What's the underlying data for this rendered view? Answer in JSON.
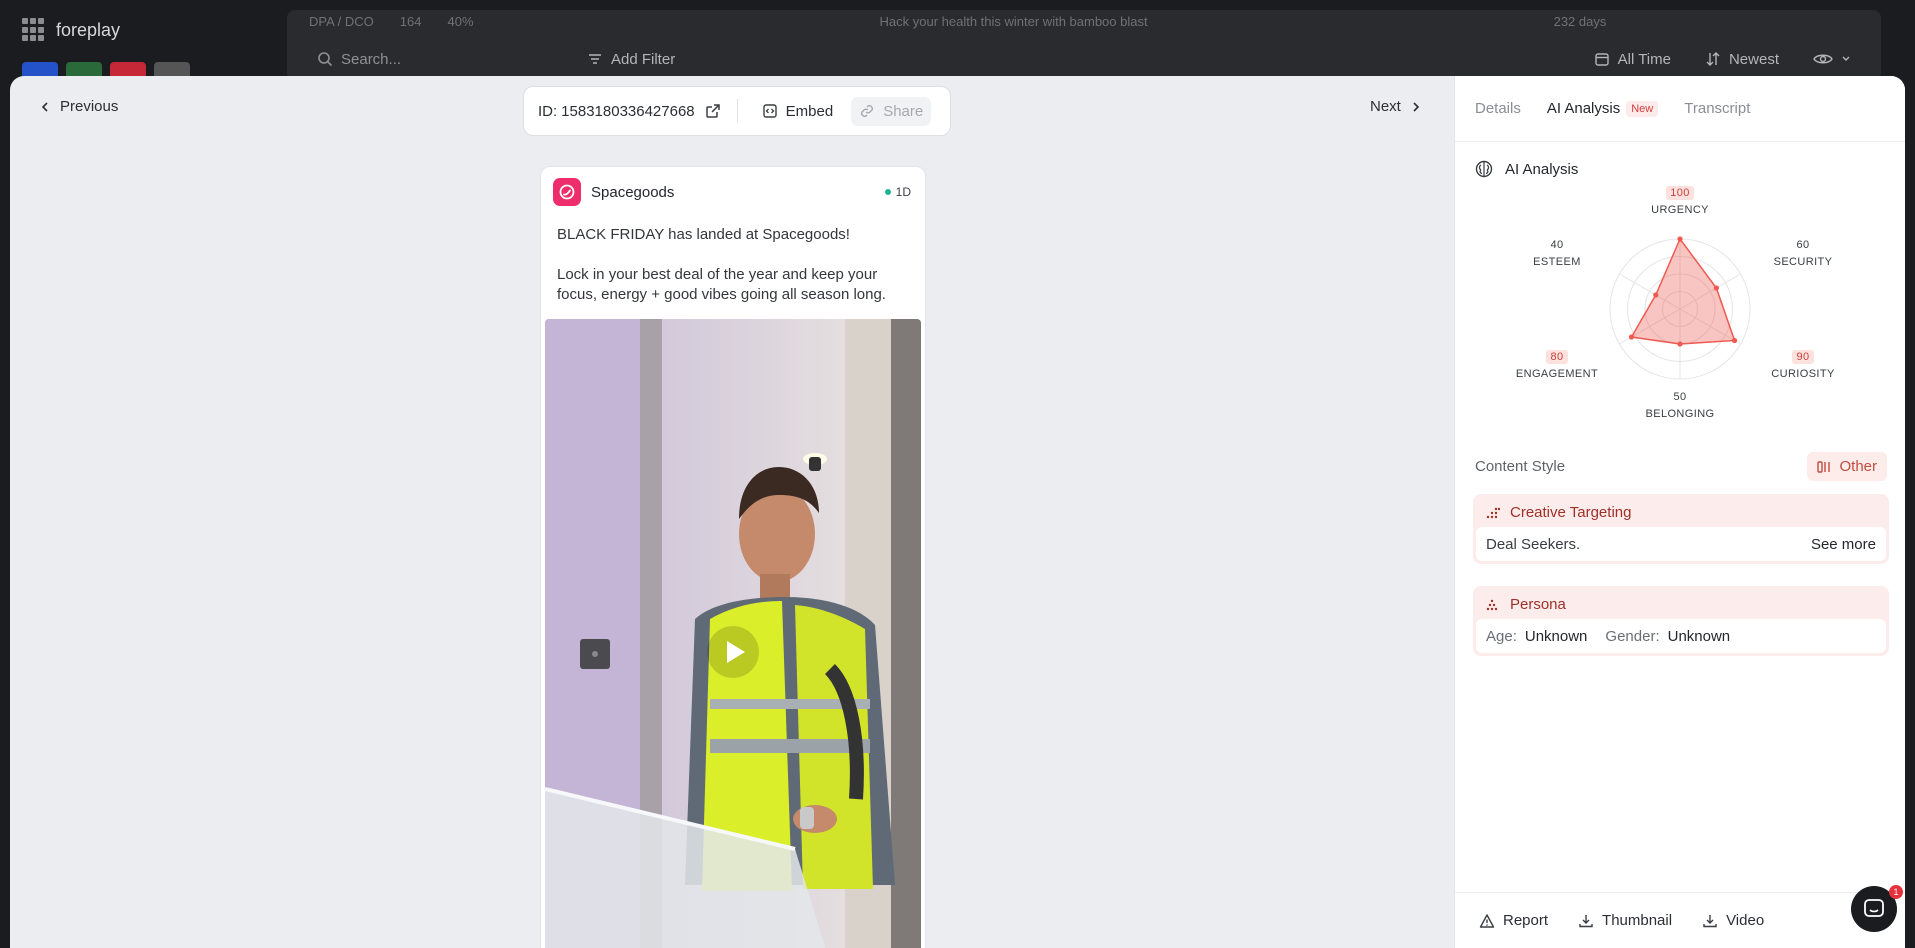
{
  "background": {
    "brand": "foreplay",
    "row1": [
      "DPA / DCO",
      "164",
      "40%",
      "Hack your health this winter with bamboo blast",
      "232 days"
    ],
    "search_placeholder": "Search...",
    "add_filter": "Add Filter",
    "all_time": "All Time",
    "newest": "Newest"
  },
  "nav": {
    "previous": "Previous",
    "next": "Next"
  },
  "idbar": {
    "id_prefix": "ID:",
    "id_value": "1583180336427668",
    "embed": "Embed",
    "share": "Share"
  },
  "ad": {
    "brand": "Spacegoods",
    "live_label": "1D",
    "copy": [
      "BLACK FRIDAY has landed at Spacegoods!",
      "Lock in your best deal of the year and keep your focus, energy + good vibes going all season long."
    ],
    "brand_color": "#ee2d6c"
  },
  "tabs": [
    {
      "label": "Details"
    },
    {
      "label": "AI Analysis",
      "badge": "New",
      "active": true
    },
    {
      "label": "Transcript"
    }
  ],
  "ai_analysis": {
    "title": "AI Analysis",
    "radar": [
      {
        "label": "URGENCY",
        "value": 100
      },
      {
        "label": "SECURITY",
        "value": 60
      },
      {
        "label": "CURIOSITY",
        "value": 90
      },
      {
        "label": "BELONGING",
        "value": 50
      },
      {
        "label": "ENGAGEMENT",
        "value": 80
      },
      {
        "label": "ESTEEM",
        "value": 40
      }
    ],
    "accent": "#ef5a50"
  },
  "content_style": {
    "label": "Content Style",
    "value": "Other"
  },
  "creative_targeting": {
    "title": "Creative Targeting",
    "value": "Deal Seekers.",
    "more": "See more"
  },
  "persona": {
    "title": "Persona",
    "age_label": "Age:",
    "age_value": "Unknown",
    "gender_label": "Gender:",
    "gender_value": "Unknown"
  },
  "footer": {
    "report": "Report",
    "thumbnail": "Thumbnail",
    "video": "Video"
  },
  "chat": {
    "badge": "1"
  }
}
